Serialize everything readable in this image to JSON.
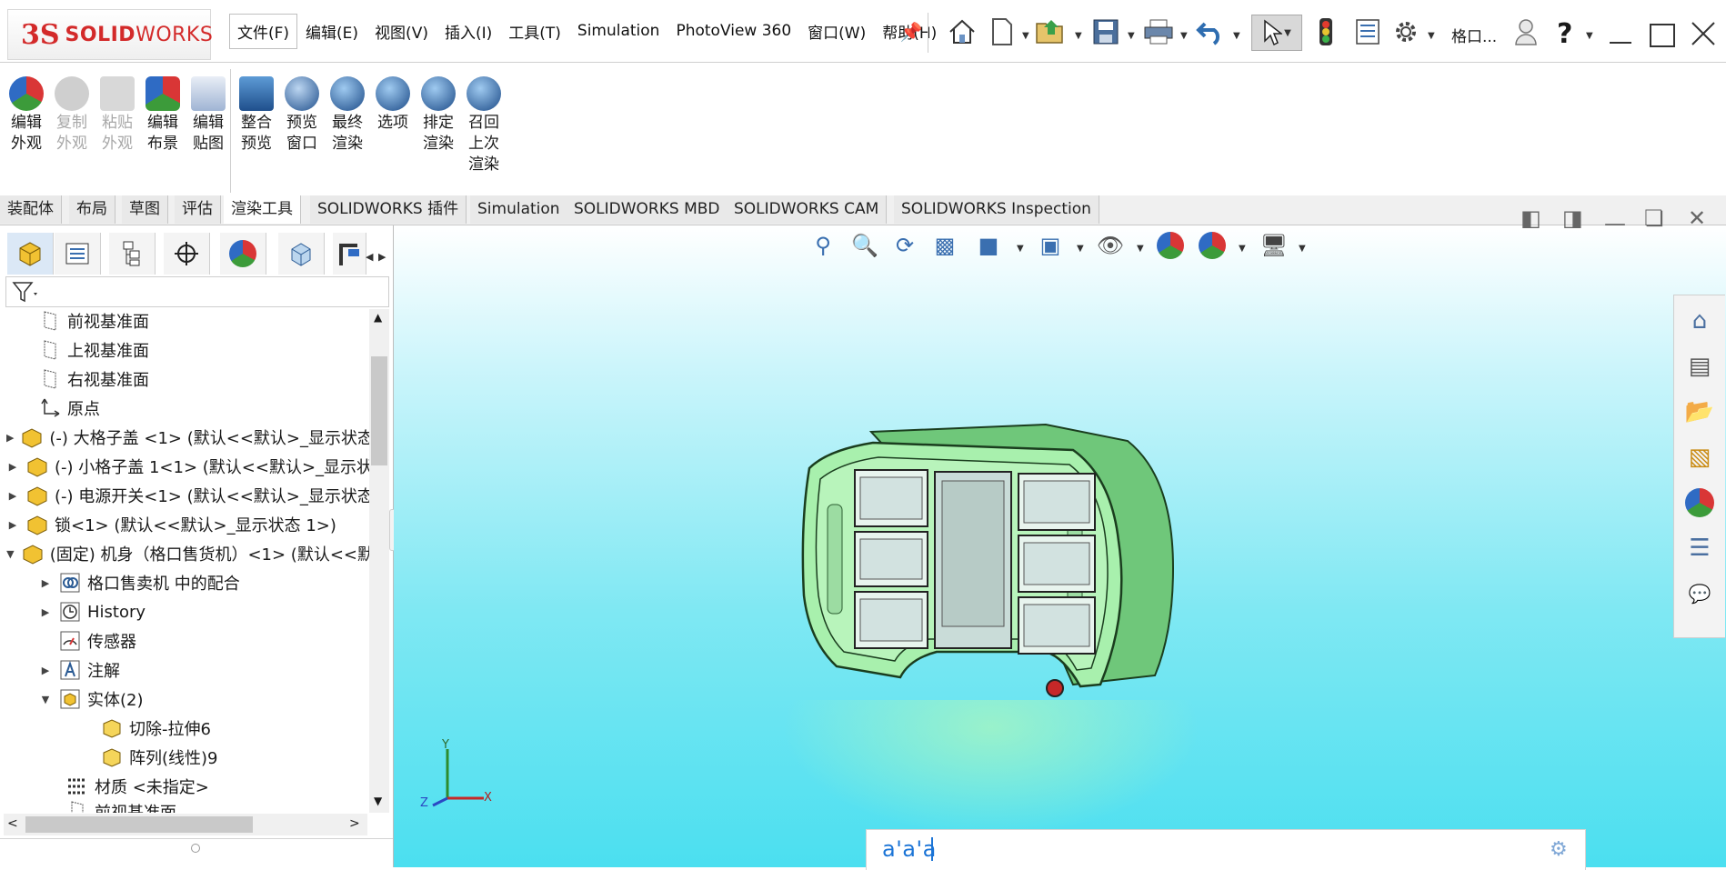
{
  "app": {
    "brand_prefix": "3S",
    "brand_main": "SOLID",
    "brand_suffix": "WORKS"
  },
  "menu": [
    "文件(F)",
    "编辑(E)",
    "视图(V)",
    "插入(I)",
    "工具(T)",
    "Simulation",
    "PhotoView 360",
    "窗口(W)",
    "帮助(H)"
  ],
  "title_short": "格口...",
  "help_glyph": "?",
  "ribbon": [
    {
      "label": "编辑\n外观",
      "enabled": true,
      "icon": "edit-appearance-icon"
    },
    {
      "label": "复制\n外观",
      "enabled": false,
      "icon": "copy-appearance-icon"
    },
    {
      "label": "粘贴\n外观",
      "enabled": false,
      "icon": "paste-appearance-icon"
    },
    {
      "label": "编辑\n布景",
      "enabled": true,
      "icon": "edit-scene-icon"
    },
    {
      "label": "编辑\n贴图",
      "enabled": true,
      "icon": "edit-decal-icon"
    },
    {
      "label": "整合\n预览",
      "enabled": true,
      "icon": "integrated-preview-icon"
    },
    {
      "label": "预览\n窗口",
      "enabled": true,
      "icon": "preview-window-icon"
    },
    {
      "label": "最终\n渲染",
      "enabled": true,
      "icon": "final-render-icon"
    },
    {
      "label": "选项",
      "enabled": true,
      "icon": "options-icon"
    },
    {
      "label": "排定\n渲染",
      "enabled": true,
      "icon": "schedule-render-icon"
    },
    {
      "label": "召回\n上次\n渲染",
      "enabled": true,
      "icon": "recall-render-icon"
    }
  ],
  "tabs": [
    "装配体",
    "布局",
    "草图",
    "评估",
    "渲染工具",
    "SOLIDWORKS 插件",
    "Simulation",
    "SOLIDWORKS MBD",
    "SOLIDWORKS CAM",
    "SOLIDWORKS Inspection"
  ],
  "active_tab": "渲染工具",
  "tree": [
    {
      "label": "前视基准面",
      "icon": "plane-icon",
      "expand": ""
    },
    {
      "label": "上视基准面",
      "icon": "plane-icon",
      "expand": ""
    },
    {
      "label": "右视基准面",
      "icon": "plane-icon",
      "expand": ""
    },
    {
      "label": "原点",
      "icon": "origin-icon",
      "expand": ""
    },
    {
      "label": "(-) 大格子盖 <1> (默认<<默认>_显示状态",
      "icon": "part-icon",
      "expand": "▶"
    },
    {
      "label": "(-) 小格子盖 1<1> (默认<<默认>_显示状",
      "icon": "part-icon",
      "expand": "▶"
    },
    {
      "label": "(-) 电源开关<1> (默认<<默认>_显示状态",
      "icon": "part-icon",
      "expand": "▶"
    },
    {
      "label": "锁<1> (默认<<默认>_显示状态 1>)",
      "icon": "part-icon",
      "expand": "▶"
    },
    {
      "label": "(固定) 机身（格口售货机）<1> (默认<<默",
      "icon": "part-icon",
      "expand": "▼"
    },
    {
      "label": "格口售卖机 中的配合",
      "icon": "mates-icon",
      "expand": "▶"
    },
    {
      "label": "History",
      "icon": "history-icon",
      "expand": "▶"
    },
    {
      "label": "传感器",
      "icon": "sensor-icon",
      "expand": ""
    },
    {
      "label": "注解",
      "icon": "annotation-icon",
      "expand": "▶"
    },
    {
      "label": "实体(2)",
      "icon": "solid-bodies-icon",
      "expand": "▼"
    },
    {
      "label": "切除-拉伸6",
      "icon": "body-icon",
      "expand": ""
    },
    {
      "label": "阵列(线性)9",
      "icon": "body-icon",
      "expand": ""
    },
    {
      "label": "材质 <未指定>",
      "icon": "material-icon",
      "expand": ""
    },
    {
      "label": "前视基准面",
      "icon": "plane-icon",
      "expand": ""
    }
  ],
  "axes": {
    "y": "Y",
    "x": "X",
    "z": "Z"
  },
  "search": {
    "value": "a'a'a"
  },
  "colors": {
    "brand": "#d32a2a",
    "model_body": "#9ef0a6",
    "viewport_bottom": "#4bdff0",
    "search_text": "#1b74d6"
  }
}
